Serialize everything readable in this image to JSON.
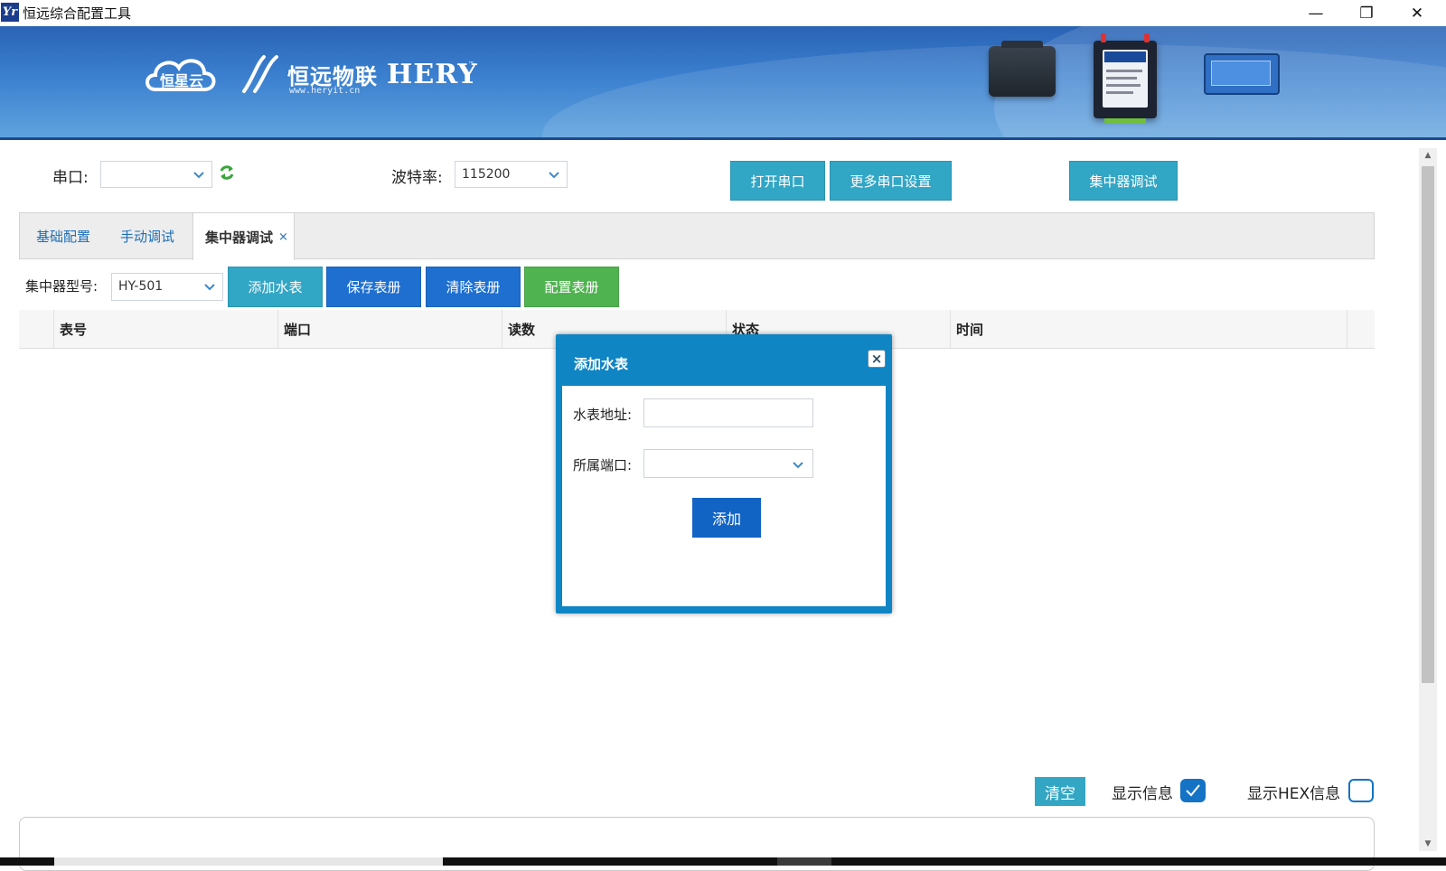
{
  "window": {
    "title": "恒远综合配置工具",
    "app_icon_text": "Yr",
    "minimize_symbol": "—",
    "restore_symbol": "❐",
    "close_symbol": "✕"
  },
  "banner": {
    "cloud_logo_text": "恒星云",
    "brand_cn": "恒远物联",
    "brand_url": "www.heryit.cn",
    "brand_en": "HERY",
    "trademark": "™"
  },
  "serial": {
    "port_label": "串口:",
    "port_value": "",
    "baud_label": "波特率:",
    "baud_value": "115200",
    "open_button": "打开串口",
    "more_settings_button": "更多串口设置",
    "concentrator_debug_button": "集中器调试"
  },
  "tabs": [
    {
      "label": "基础配置",
      "active": false
    },
    {
      "label": "手动调试",
      "active": false
    },
    {
      "label": "集中器调试",
      "active": true,
      "close": "×"
    }
  ],
  "concentrator": {
    "model_label": "集中器型号:",
    "model_value": "HY-501",
    "add_meter_button": "添加水表",
    "save_register_button": "保存表册",
    "clear_register_button": "清除表册",
    "config_register_button": "配置表册"
  },
  "table": {
    "columns": [
      "表号",
      "端口",
      "读数",
      "状态",
      "时间"
    ],
    "rows": []
  },
  "dialog": {
    "title": "添加水表",
    "close_symbol": "×",
    "address_label": "水表地址:",
    "address_value": "",
    "port_label": "所属端口:",
    "port_value": "",
    "add_button": "添加"
  },
  "footer": {
    "clear_button": "清空",
    "show_info_label": "显示信息",
    "show_info_checked": true,
    "show_hex_label": "显示HEX信息",
    "show_hex_checked": false
  },
  "colors": {
    "accent_blue": "#1e6fd0",
    "accent_cyan": "#32a6c5",
    "accent_green": "#4fb34f",
    "dialog_header": "#0f85c4",
    "tab_link": "#1d6fb6"
  }
}
